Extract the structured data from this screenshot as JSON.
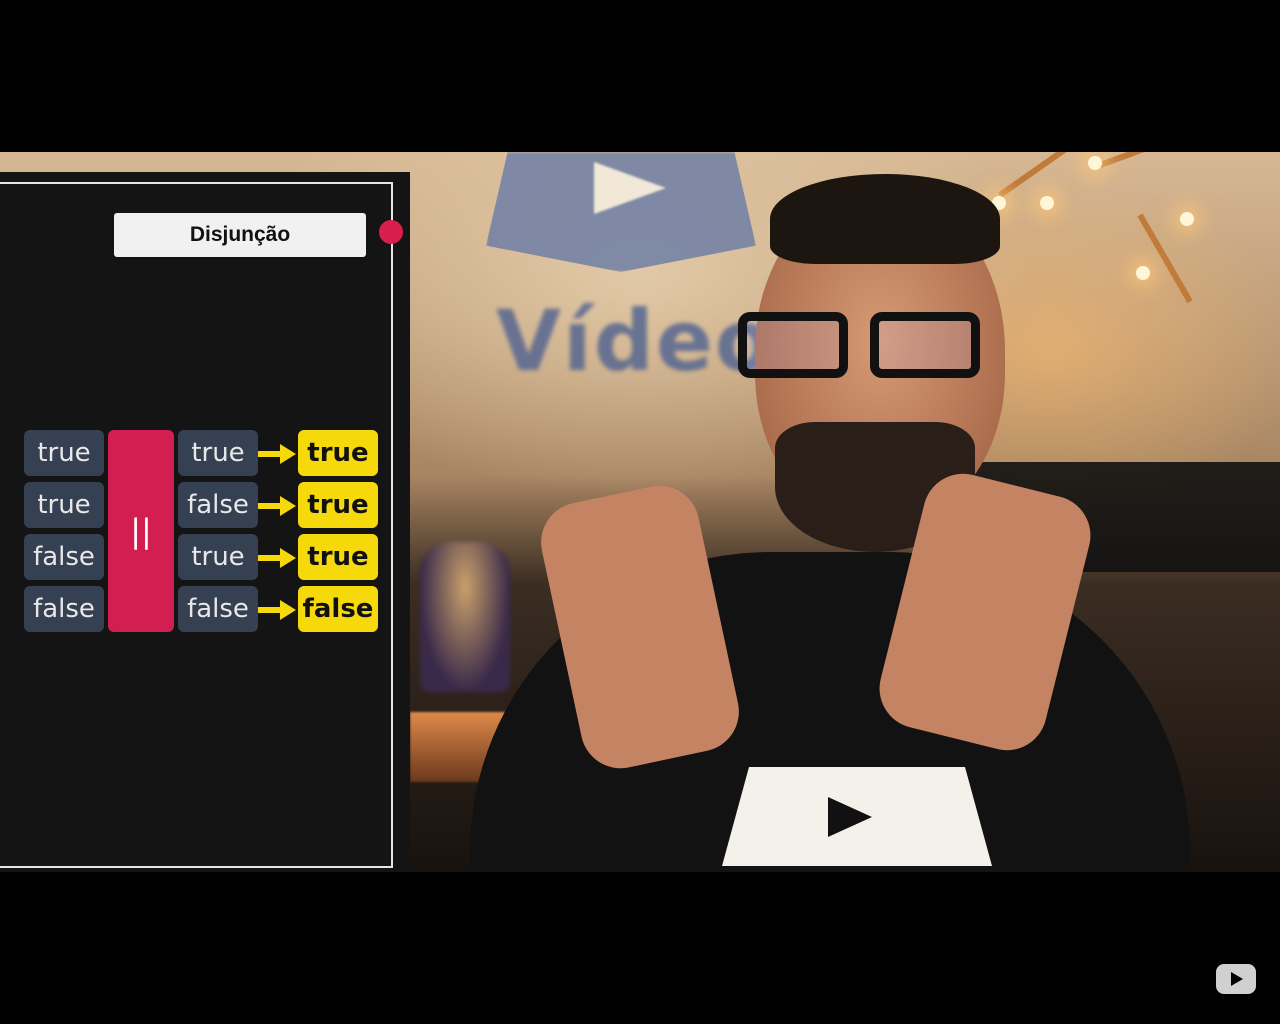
{
  "overlay": {
    "title": "Disjunção",
    "operator": "||",
    "rows": [
      {
        "left": "true",
        "right": "true",
        "result": "true"
      },
      {
        "left": "true",
        "right": "false",
        "result": "true"
      },
      {
        "left": "false",
        "right": "true",
        "result": "true"
      },
      {
        "left": "false",
        "right": "false",
        "result": "false"
      }
    ],
    "colors": {
      "operand_bg": "#354152",
      "operator_bg": "#d21e50",
      "result_bg": "#f5d90b",
      "record_dot": "#d81e4d"
    }
  },
  "background": {
    "wall_text": "Vídeo"
  },
  "player": {
    "logo_icon": "youtube-logo-icon"
  }
}
